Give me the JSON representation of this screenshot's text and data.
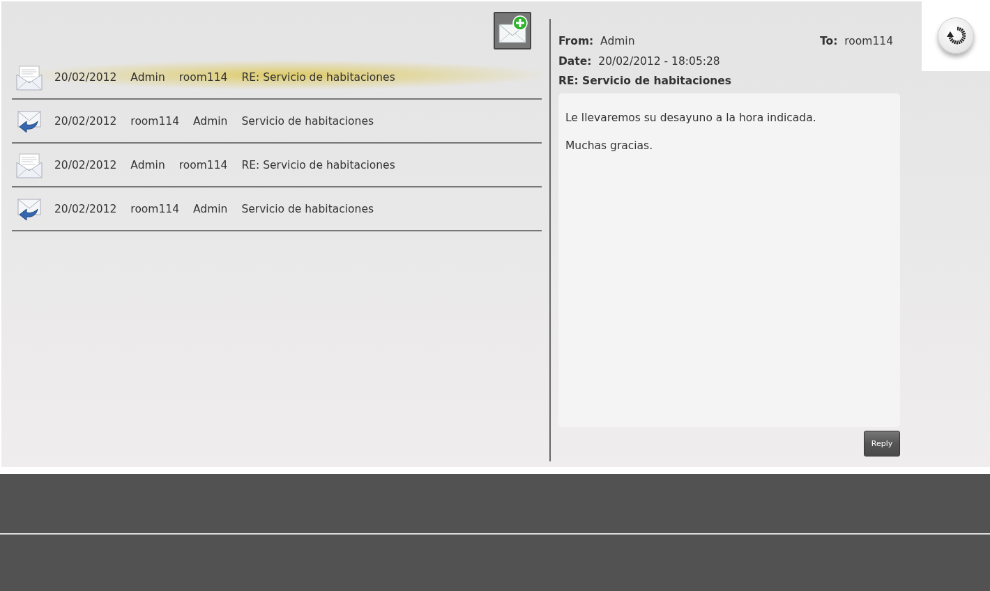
{
  "messages": [
    {
      "kind": "received",
      "selected": true,
      "date": "20/02/2012",
      "from": "Admin",
      "to": "room114",
      "subject": "RE: Servicio de habitaciones"
    },
    {
      "kind": "sent",
      "selected": false,
      "date": "20/02/2012",
      "from": "room114",
      "to": "Admin",
      "subject": "Servicio de habitaciones"
    },
    {
      "kind": "received",
      "selected": false,
      "date": "20/02/2012",
      "from": "Admin",
      "to": "room114",
      "subject": "RE: Servicio de habitaciones"
    },
    {
      "kind": "sent",
      "selected": false,
      "date": "20/02/2012",
      "from": "room114",
      "to": "Admin",
      "subject": "Servicio de habitaciones"
    }
  ],
  "detail": {
    "from_label": "From:",
    "from": "Admin",
    "to_label": "To:",
    "to": "room114",
    "date_label": "Date:",
    "date": "20/02/2012 - 18:05:28",
    "subject": "RE: Servicio de habitaciones",
    "body": [
      "Le llevaremos su desayuno a la hora indicada.",
      "Muchas gracias."
    ],
    "reply_button": "Reply"
  }
}
